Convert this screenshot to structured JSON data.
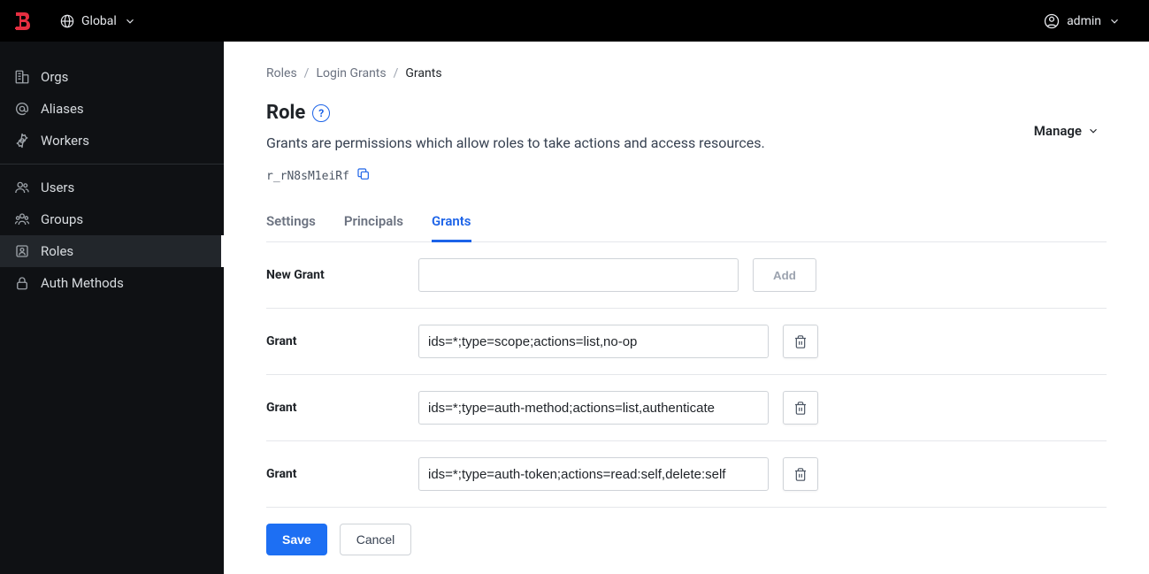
{
  "topbar": {
    "scope_label": "Global",
    "user_label": "admin"
  },
  "sidebar": {
    "section1": [
      {
        "icon": "building",
        "label": "Orgs"
      },
      {
        "icon": "at",
        "label": "Aliases"
      },
      {
        "icon": "gear",
        "label": "Workers"
      }
    ],
    "section2": [
      {
        "icon": "users",
        "label": "Users"
      },
      {
        "icon": "group",
        "label": "Groups"
      },
      {
        "icon": "id-badge",
        "label": "Roles",
        "active": true
      },
      {
        "icon": "lock",
        "label": "Auth Methods"
      }
    ]
  },
  "breadcrumbs": {
    "items": [
      {
        "label": "Roles"
      },
      {
        "label": "Login Grants"
      },
      {
        "label": "Grants",
        "current": true
      }
    ]
  },
  "header": {
    "title": "Role",
    "subtitle": "Grants are permissions which allow roles to take actions and access resources.",
    "manage_label": "Manage",
    "role_id": "r_rN8sM1eiRf"
  },
  "tabs": {
    "items": [
      {
        "label": "Settings"
      },
      {
        "label": "Principals"
      },
      {
        "label": "Grants",
        "active": true
      }
    ]
  },
  "form": {
    "new_grant_label": "New Grant",
    "add_label": "Add",
    "grant_label": "Grant",
    "grants": [
      "ids=*;type=scope;actions=list,no-op",
      "ids=*;type=auth-method;actions=list,authenticate",
      "ids=*;type=auth-token;actions=read:self,delete:self"
    ],
    "save_label": "Save",
    "cancel_label": "Cancel"
  }
}
